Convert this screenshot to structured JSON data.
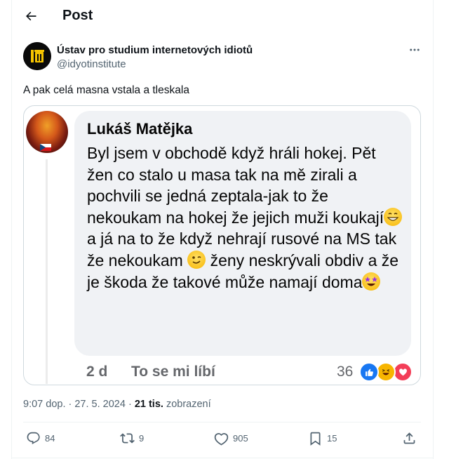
{
  "header": {
    "title": "Post",
    "back_icon": "arrow-left-icon"
  },
  "tweet": {
    "author_name": "Ústav pro studium internetových idiotů",
    "author_handle": "@idyotinstitute",
    "text": "A pak celá masna vstala a tleskala",
    "time_text": "9:07 dop. · 27. 5. 2024 · ",
    "views_count": "21 tis.",
    "views_label": " zobrazení"
  },
  "fb_comment": {
    "name": "Lukáš Matějka",
    "text_part1": "Byl jsem v obchodě když hráli hokej. Pět žen co stalo u masa tak na mě zirali  a pochvili se jedná zeptala-jak to že nekoukam na hokej že jejich muži koukají",
    "text_part2": "a já na to že když nehrají rusové na MS tak že nekoukam ",
    "text_part3": " ženy neskrývali obdiv a že je škoda že takové může namají doma",
    "time": "2 d",
    "like_label": "To se mi líbí",
    "reaction_count": "36",
    "reactions": [
      "like-icon",
      "haha-icon",
      "love-icon"
    ]
  },
  "actions": {
    "replies": "84",
    "reposts": "9",
    "likes": "905",
    "bookmarks": "15"
  },
  "colors": {
    "text": "#0f1419",
    "secondary": "#536471",
    "fb_bubble": "#f0f2f5",
    "fb_text": "#050505"
  }
}
